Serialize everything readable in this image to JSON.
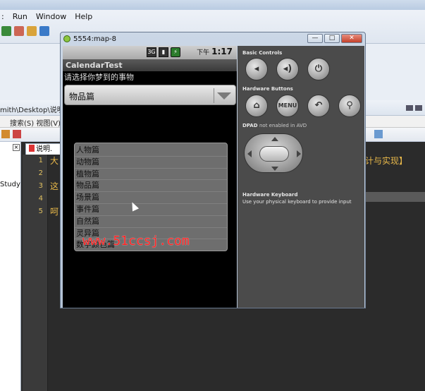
{
  "eclipse": {
    "menu": [
      "Run",
      "Window",
      "Help"
    ],
    "path": "mith\\Desktop\\说明.t",
    "subtoolbar": "搜索(S)  视图(V)",
    "left_label": "Study",
    "tab_label": "说明.",
    "line_numbers": [
      "1",
      "2",
      "3",
      "4",
      "5"
    ],
    "lines": [
      "大",
      "",
      "这",
      "",
      "呵"
    ],
    "right_text": "计与实现】"
  },
  "emulator": {
    "window_title": "5554:map-8",
    "min_label": "—",
    "max_label": "□",
    "close_label": "✕",
    "status": {
      "signal_label": "3G",
      "time_prefix": "下午",
      "time": "1:17"
    },
    "app_title": "CalendarTest",
    "prompt": "请选择你梦到的事物",
    "spinner_value": "物品篇",
    "dropdown_items": [
      "人物篇",
      "动物篇",
      "植物篇",
      "物品篇",
      "场景篇",
      "事件篇",
      "自然篇",
      "灵异篇",
      "数字颜色篇"
    ],
    "watermark": "www.51ccsj.com",
    "controls": {
      "basic_label": "Basic Controls",
      "hardware_label": "Hardware Buttons",
      "dpad_label": "DPAD",
      "dpad_note": "not enabled in AVD",
      "menu_label": "MENU",
      "keyboard_title": "Hardware Keyboard",
      "keyboard_note": "Use your physical keyboard to provide input"
    }
  }
}
